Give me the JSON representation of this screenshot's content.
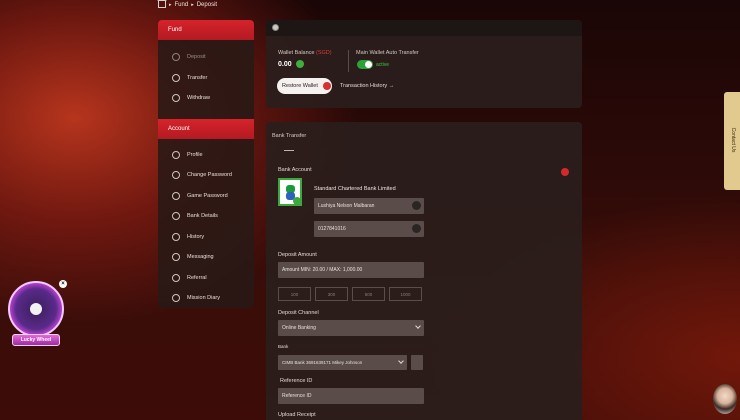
{
  "breadcrumb": {
    "fund": "Fund",
    "deposit": "Deposit"
  },
  "sidebar": {
    "fund_header": "Fund",
    "fund_items": [
      {
        "label": "Deposit",
        "icon": "deposit-icon",
        "active": true
      },
      {
        "label": "Transfer",
        "icon": "transfer-icon"
      },
      {
        "label": "Withdraw",
        "icon": "withdraw-icon"
      }
    ],
    "account_header": "Account",
    "account_items": [
      {
        "label": "Profile",
        "icon": "profile-icon"
      },
      {
        "label": "Change Password",
        "icon": "key-icon"
      },
      {
        "label": "Game Password",
        "icon": "game-key-icon"
      },
      {
        "label": "Bank Details",
        "icon": "bank-icon"
      },
      {
        "label": "History",
        "icon": "history-icon"
      },
      {
        "label": "Messaging",
        "icon": "mail-icon"
      },
      {
        "label": "Referral",
        "icon": "referral-icon"
      },
      {
        "label": "Mission Diary",
        "icon": "diary-icon"
      }
    ]
  },
  "wallet": {
    "balance_label": "Wallet Balance",
    "currency": "(SGD)",
    "balance_value": "0.00",
    "auto_transfer_label": "Main Wallet Auto Transfer",
    "auto_transfer_state": "active",
    "restore_label": "Restore Wallet",
    "history_link": "Transaction History →"
  },
  "bank_transfer": {
    "title": "Bank Transfer",
    "bank_account_label": "Bank Account",
    "bank_name": "Standard Chartered Bank Limited",
    "account_holder": "Lushiya Nelson Malbaran",
    "account_number": "0127841016",
    "deposit_amount_label": "Deposit Amount",
    "amount_placeholder": "Amount MIN: 20.00 / MAX: 1,000.00",
    "amount_chips": [
      "100",
      "300",
      "500",
      "1000"
    ],
    "channel_label": "Deposit Channel",
    "channel_value": "Online Banking",
    "bank_label": "Bank",
    "bank_value": "CIMB Bank 3691639171 Mikey Johnson",
    "reference_label": "Reference ID",
    "reference_placeholder": "Reference ID",
    "upload_label": "Upload Receipt"
  },
  "contact_tab": "Contact Us",
  "lucky_wheel": {
    "label": "Lucky Wheel",
    "close": "×"
  },
  "colors": {
    "accent": "#d6232b",
    "active_green": "#2ea23a"
  }
}
